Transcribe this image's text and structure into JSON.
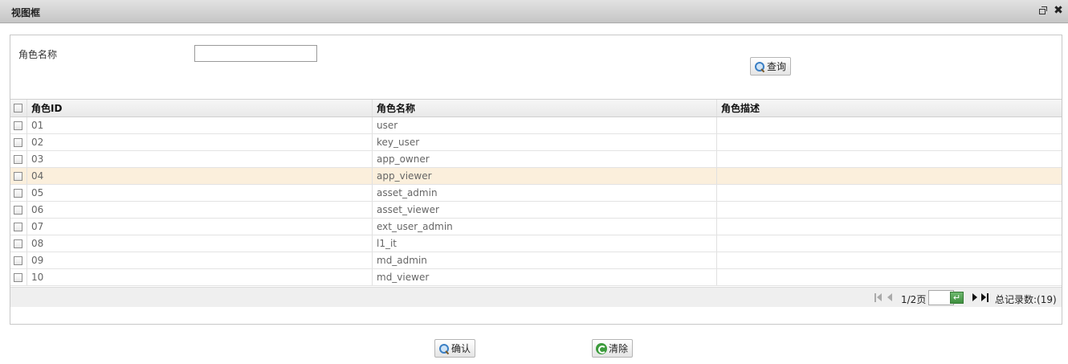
{
  "window": {
    "title": "视图框",
    "restore_icon": "restore-icon",
    "close_icon": "close-icon",
    "close_glyph": "✖"
  },
  "search": {
    "label": "角色名称",
    "value": "",
    "placeholder": "",
    "query_button": "查询",
    "query_icon": "magnifier-icon"
  },
  "table": {
    "columns": [
      "角色ID",
      "角色名称",
      "角色描述"
    ],
    "rows": [
      {
        "id": "01",
        "name": "user",
        "desc": ""
      },
      {
        "id": "02",
        "name": "key_user",
        "desc": ""
      },
      {
        "id": "03",
        "name": "app_owner",
        "desc": ""
      },
      {
        "id": "04",
        "name": "app_viewer",
        "desc": "",
        "highlighted": true
      },
      {
        "id": "05",
        "name": "asset_admin",
        "desc": ""
      },
      {
        "id": "06",
        "name": "asset_viewer",
        "desc": ""
      },
      {
        "id": "07",
        "name": "ext_user_admin",
        "desc": ""
      },
      {
        "id": "08",
        "name": "l1_it",
        "desc": ""
      },
      {
        "id": "09",
        "name": "md_admin",
        "desc": ""
      },
      {
        "id": "10",
        "name": "md_viewer",
        "desc": ""
      }
    ],
    "highlight_color": "#fbefdc"
  },
  "pager": {
    "page_text": "1/2页",
    "page_input": "",
    "go_glyph": "↵",
    "total_text": "总记录数:(19)"
  },
  "footer": {
    "confirm_button": "确认",
    "confirm_icon": "magnifier-icon",
    "clear_button": "清除",
    "clear_icon": "refresh-icon"
  }
}
